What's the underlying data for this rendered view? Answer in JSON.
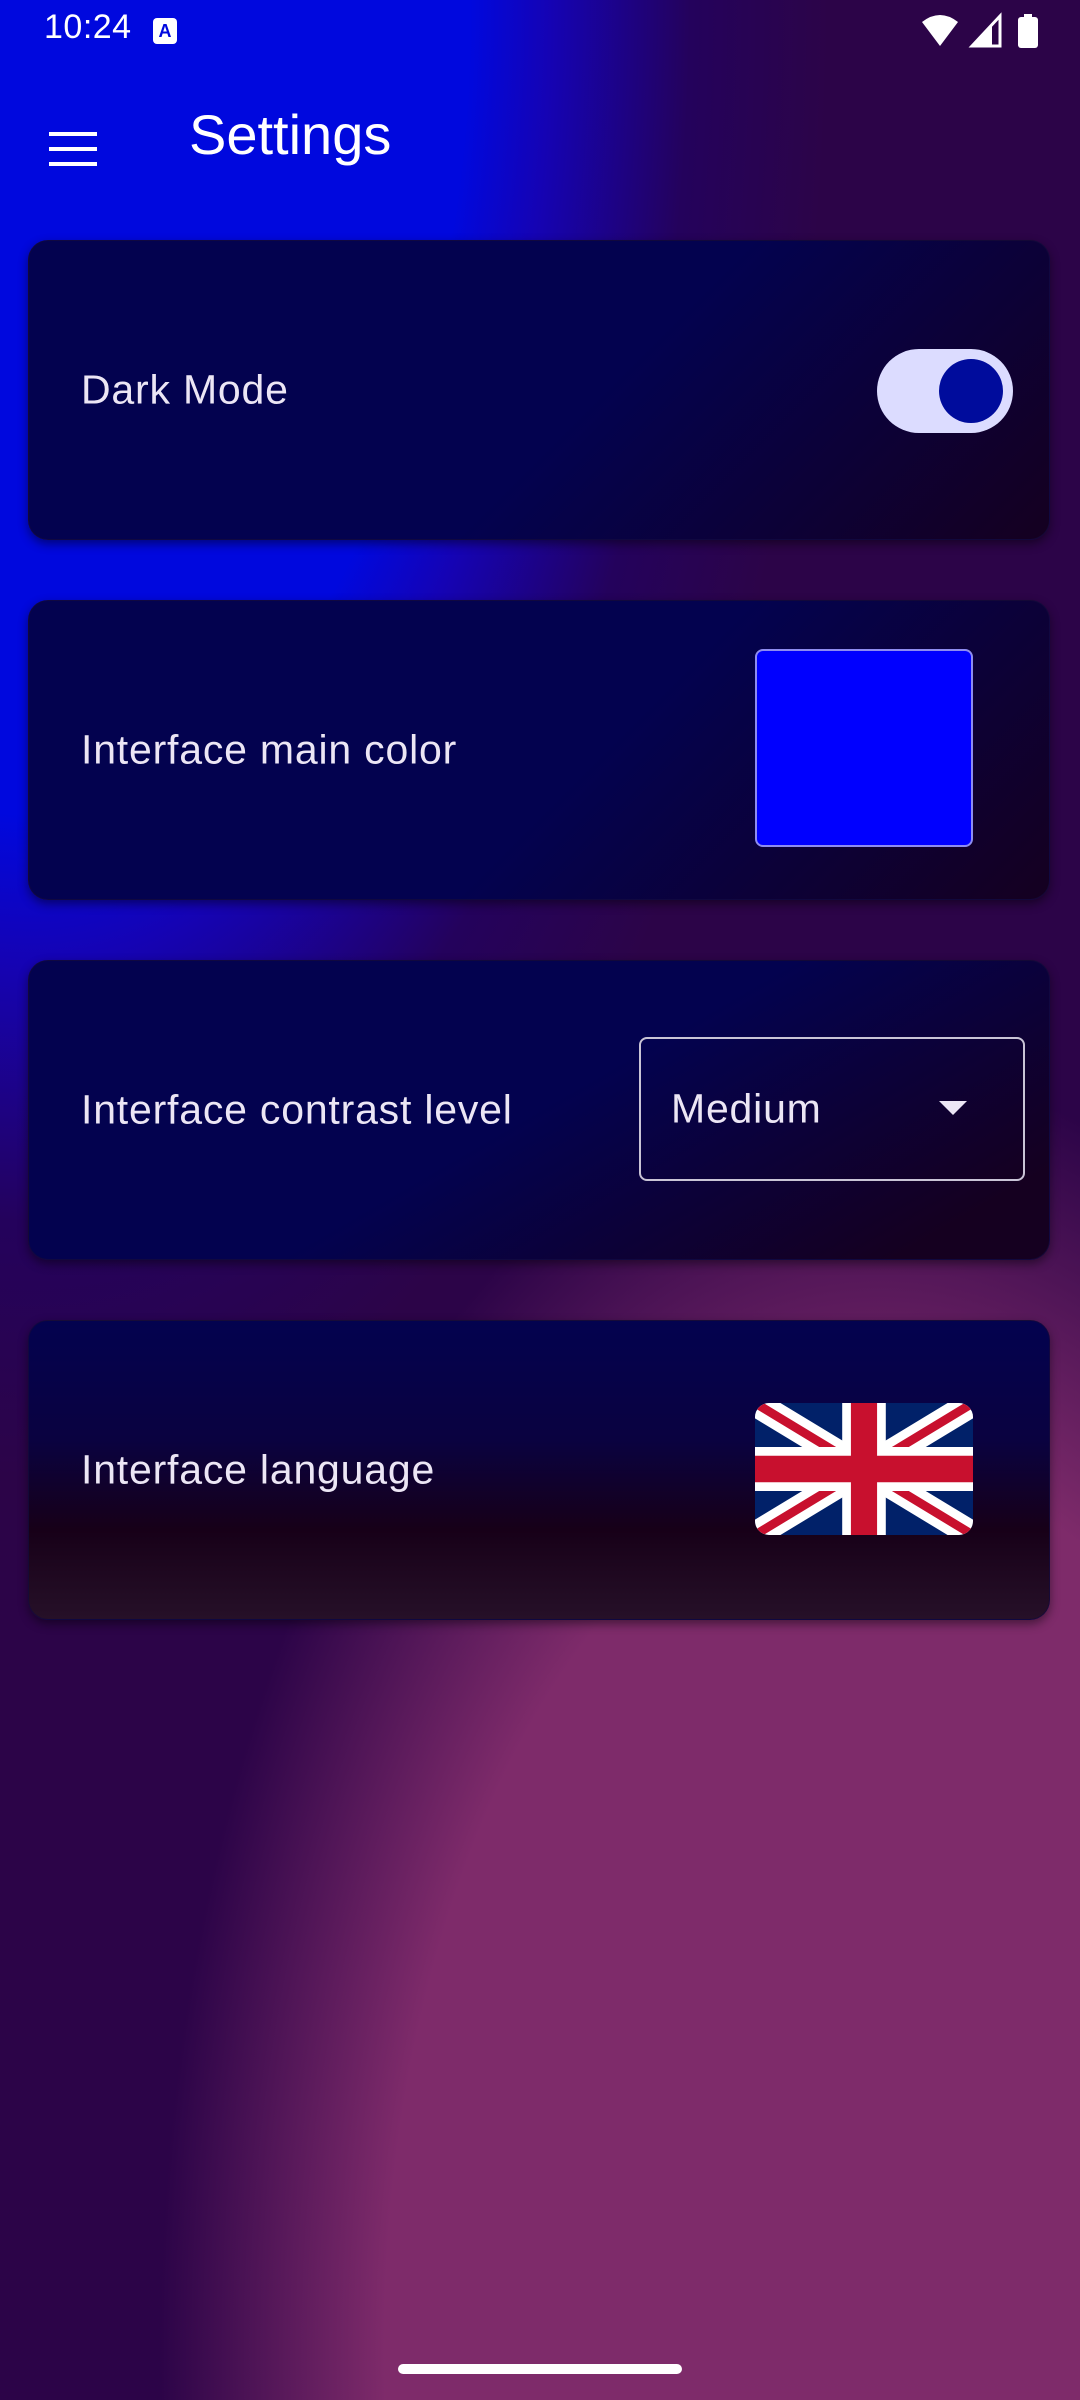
{
  "status_bar": {
    "time": "10:24",
    "notification_icon": "accessibility-notification-icon",
    "notification_glyph": "A",
    "icons": [
      "wifi-icon",
      "cellular-signal-icon",
      "battery-icon"
    ]
  },
  "app_bar": {
    "menu_icon": "hamburger-menu-icon",
    "title": "Settings"
  },
  "settings": {
    "dark_mode": {
      "label": "Dark Mode",
      "enabled": true
    },
    "main_color": {
      "label": "Interface main color",
      "value": "#0000ff"
    },
    "contrast": {
      "label": "Interface contrast level",
      "value": "Medium"
    },
    "language": {
      "label": "Interface language",
      "flag_icon": "uk-flag-icon"
    }
  },
  "colors": {
    "background_blue": "#0008de",
    "background_purple": "#2c0448",
    "background_magenta": "#7e2b6a",
    "card": "#03024f",
    "toggle_track": "#dcdcff",
    "toggle_thumb": "#000c9c",
    "text": "#ece6f5"
  }
}
